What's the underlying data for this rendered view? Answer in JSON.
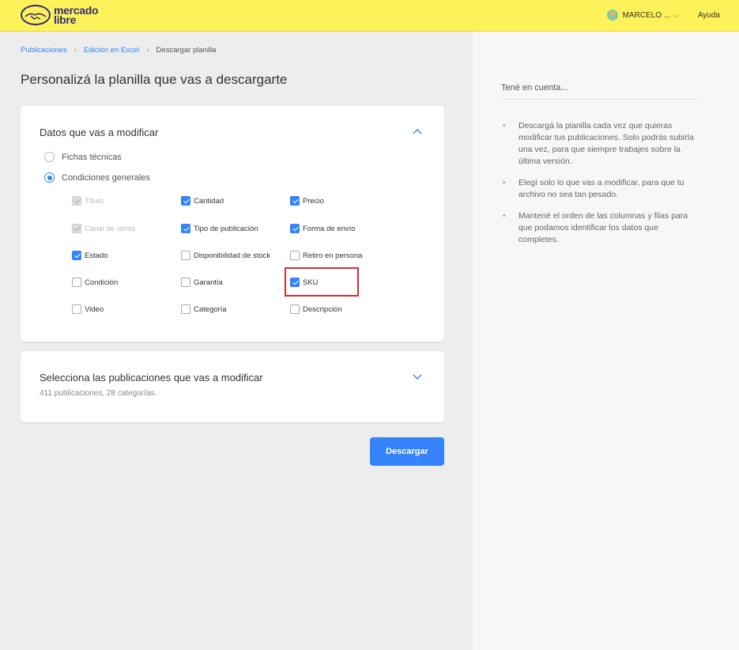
{
  "header": {
    "logo_line1": "mercado",
    "logo_line2": "libre",
    "user_name": "MARCELO ...",
    "help_label": "Ayuda",
    "bg_color": "#fff159"
  },
  "breadcrumb": [
    {
      "label": "Publicaciones"
    },
    {
      "label": "Edición en Excel"
    },
    {
      "label": "Descargar planilla"
    }
  ],
  "page_title": "Personalizá la planilla que vas a descargarte",
  "section_data": {
    "title": "Datos que vas a modificar",
    "radios": [
      {
        "label": "Fichas técnicas",
        "selected": false
      },
      {
        "label": "Condiciones generales",
        "selected": true
      }
    ],
    "checkboxes": [
      {
        "label": "Título",
        "checked": true,
        "disabled": true
      },
      {
        "label": "Cantidad",
        "checked": true,
        "disabled": false
      },
      {
        "label": "Precio",
        "checked": true,
        "disabled": false
      },
      {
        "label": "Canal de venta",
        "checked": true,
        "disabled": true
      },
      {
        "label": "Tipo de publicación",
        "checked": true,
        "disabled": false
      },
      {
        "label": "Forma de envío",
        "checked": true,
        "disabled": false
      },
      {
        "label": "Estado",
        "checked": true,
        "disabled": false
      },
      {
        "label": "Disponibilidad de stock",
        "checked": false,
        "disabled": false
      },
      {
        "label": "Retiro en persona",
        "checked": false,
        "disabled": false
      },
      {
        "label": "Condición",
        "checked": false,
        "disabled": false
      },
      {
        "label": "Garantía",
        "checked": false,
        "disabled": false
      },
      {
        "label": "SKU",
        "checked": true,
        "disabled": false
      },
      {
        "label": "Video",
        "checked": false,
        "disabled": false
      },
      {
        "label": "Categoría",
        "checked": false,
        "disabled": false
      },
      {
        "label": "Descripción",
        "checked": false,
        "disabled": false
      }
    ]
  },
  "section_publications": {
    "title": "Selecciona las publicaciones que vas a modificar",
    "subtitle": "411 publicaciones, 28 categorías."
  },
  "download_button": "Descargar",
  "aside": {
    "title": "Tené en cuenta...",
    "tips": [
      "Descargá la planilla cada vez que quieras modificar tus publicaciones. Solo podrás subirla una vez, para que siempre trabajes sobre la última versión.",
      "Elegí solo lo que vas a modificar, para que tu archivo no sea tan pesado.",
      "Mantené el orden de las columnas y filas para que podamos identificar los datos que completes."
    ]
  },
  "colors": {
    "accent": "#3483fa",
    "highlight": "#d32f2f"
  }
}
